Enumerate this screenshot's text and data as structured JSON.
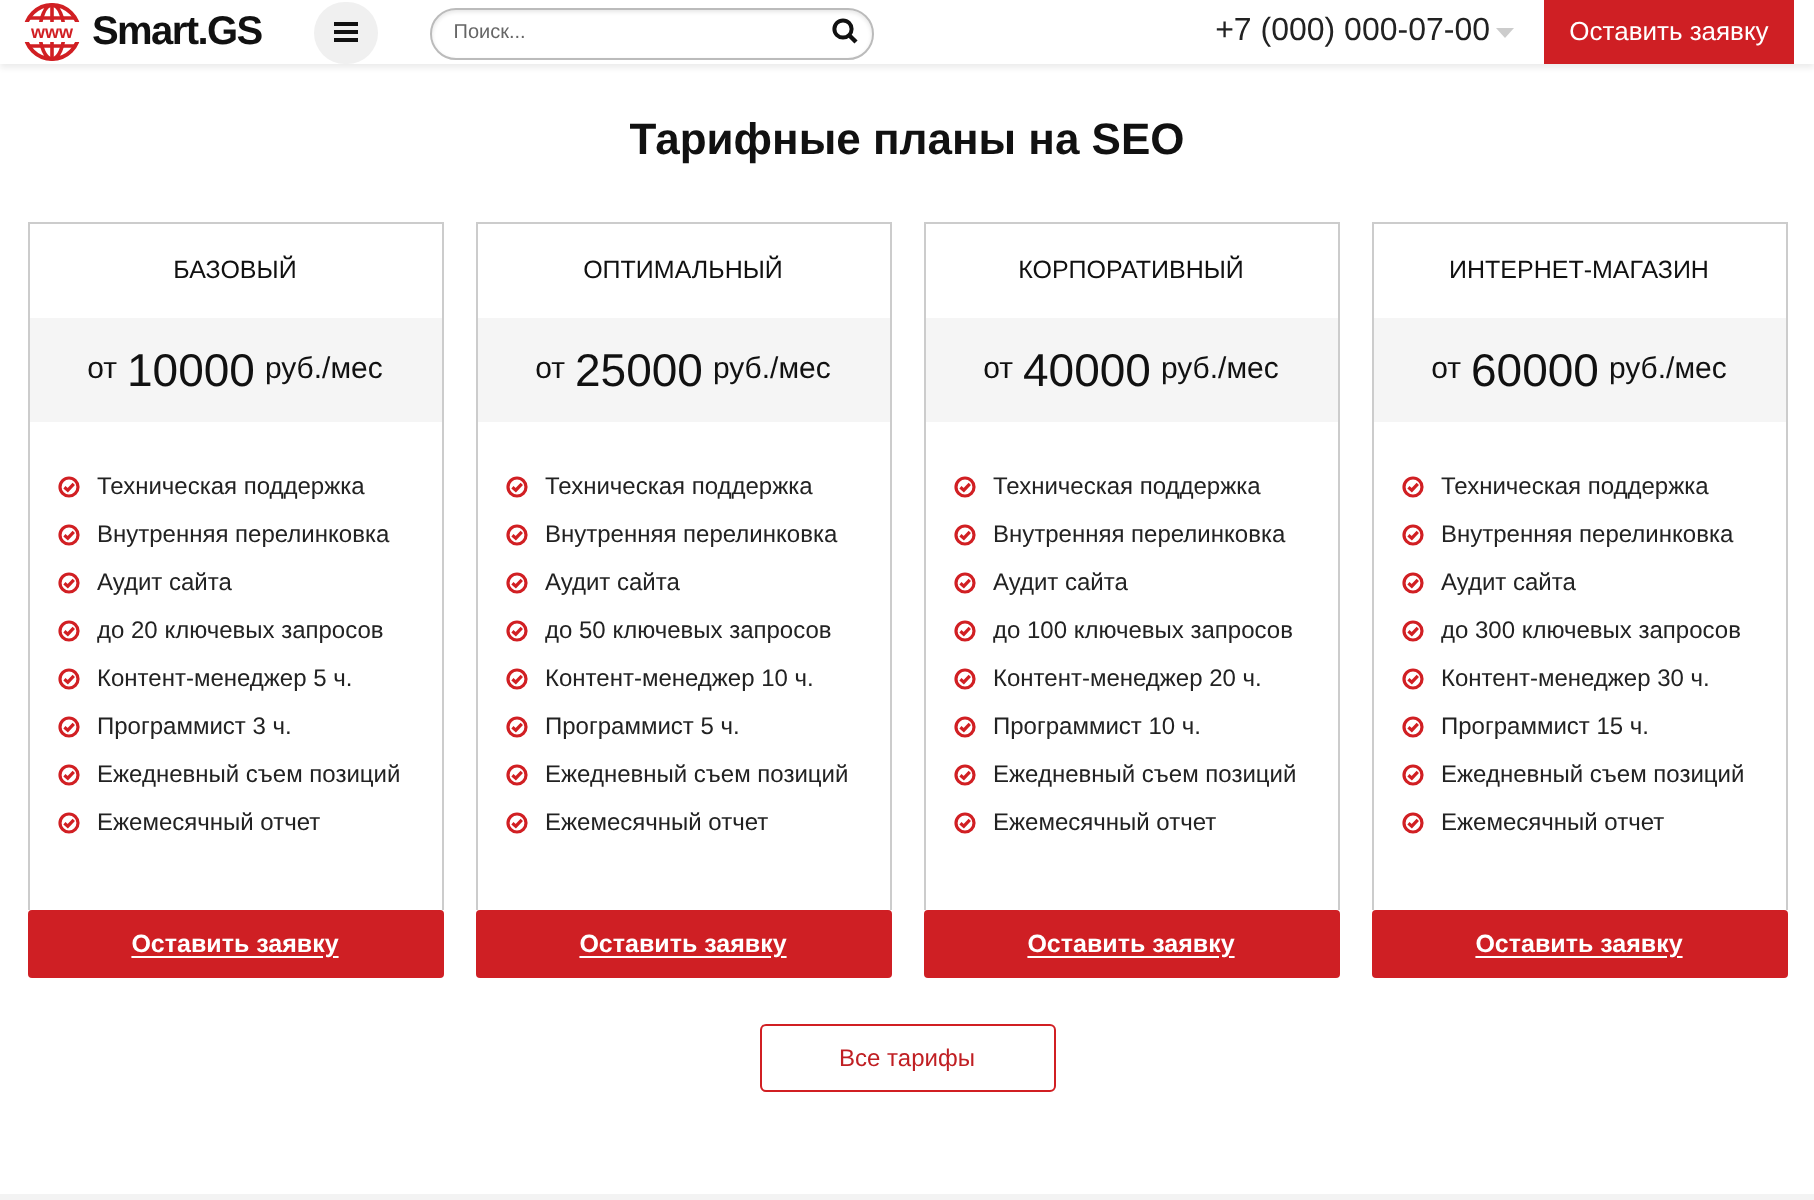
{
  "header": {
    "logo": {
      "badge": "www",
      "name": "Smart.GS"
    },
    "search": {
      "placeholder": "Поиск..."
    },
    "phone": "+7 (000) 000-07-00",
    "cta": "Оставить заявку"
  },
  "section": {
    "title": "Тарифные планы на SEO",
    "plans": [
      {
        "name": "БАЗОВЫЙ",
        "price": {
          "prefix": "от",
          "amount": "10000",
          "unit": "руб./мес"
        },
        "features": [
          "Техническая поддержка",
          "Внутренняя перелинковка",
          "Аудит сайта",
          "до 20 ключевых запросов",
          "Контент-менеджер 5 ч.",
          "Программист 3 ч.",
          "Ежедневный съем позиций",
          "Ежемесячный отчет"
        ],
        "button": "Оставить заявку"
      },
      {
        "name": "ОПТИМАЛЬНЫЙ",
        "price": {
          "prefix": "от",
          "amount": "25000",
          "unit": "руб./мес"
        },
        "features": [
          "Техническая поддержка",
          "Внутренняя перелинковка",
          "Аудит сайта",
          "до 50 ключевых запросов",
          "Контент-менеджер 10 ч.",
          "Программист 5 ч.",
          "Ежедневный съем позиций",
          "Ежемесячный отчет"
        ],
        "button": "Оставить заявку"
      },
      {
        "name": "КОРПОРАТИВНЫЙ",
        "price": {
          "prefix": "от",
          "amount": "40000",
          "unit": "руб./мес"
        },
        "features": [
          "Техническая поддержка",
          "Внутренняя перелинковка",
          "Аудит сайта",
          "до 100 ключевых запросов",
          "Контент-менеджер 20 ч.",
          "Программист 10 ч.",
          "Ежедневный съем позиций",
          "Ежемесячный отчет"
        ],
        "button": "Оставить заявку"
      },
      {
        "name": "ИНТЕРНЕТ-МАГАЗИН",
        "price": {
          "prefix": "от",
          "amount": "60000",
          "unit": "руб./мес"
        },
        "features": [
          "Техническая поддержка",
          "Внутренняя перелинковка",
          "Аудит сайта",
          "до 300 ключевых запросов",
          "Контент-менеджер 30 ч.",
          "Программист 15 ч.",
          "Ежедневный съем позиций",
          "Ежемесячный отчет"
        ],
        "button": "Оставить заявку"
      }
    ],
    "all_button": "Все тарифы"
  }
}
